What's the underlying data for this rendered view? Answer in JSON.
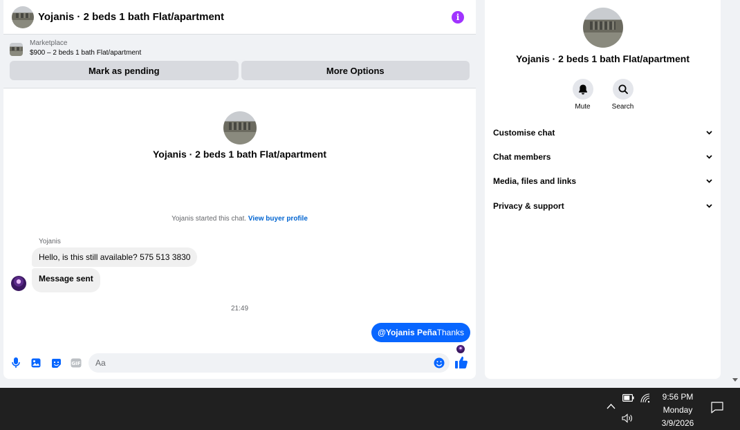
{
  "chat": {
    "title": "Yojanis · 2 beds 1 bath Flat/apartment",
    "listing": {
      "label": "Marketplace",
      "price_title": "$900 – 2 beds 1 bath Flat/apartment",
      "mark_pending_label": "Mark as pending",
      "more_options_label": "More Options"
    },
    "intro_title": "Yojanis · 2 beds 1 bath Flat/apartment",
    "started_text": "Yojanis started this chat.",
    "view_buyer_profile": "View buyer profile",
    "sender_name": "Yojanis",
    "messages_in": [
      "Hello, is this still available? 575 513 3830",
      "Message sent"
    ],
    "timestamp": "21:49",
    "message_out": {
      "mention": "@Yojanis Peña",
      "text": "Thanks"
    },
    "composer": {
      "placeholder": "Aa"
    },
    "accent_color": "#0866ff"
  },
  "info_panel": {
    "title": "Yojanis · 2 beds 1 bath Flat/apartment",
    "actions": [
      {
        "label": "Mute",
        "icon": "bell-icon"
      },
      {
        "label": "Search",
        "icon": "search-icon"
      }
    ],
    "menu": [
      {
        "label": "Customise chat"
      },
      {
        "label": "Chat members"
      },
      {
        "label": "Media, files and links"
      },
      {
        "label": "Privacy & support"
      }
    ]
  },
  "taskbar": {
    "time": "9:56 PM",
    "day": "Monday",
    "date": "3/9/2026"
  }
}
